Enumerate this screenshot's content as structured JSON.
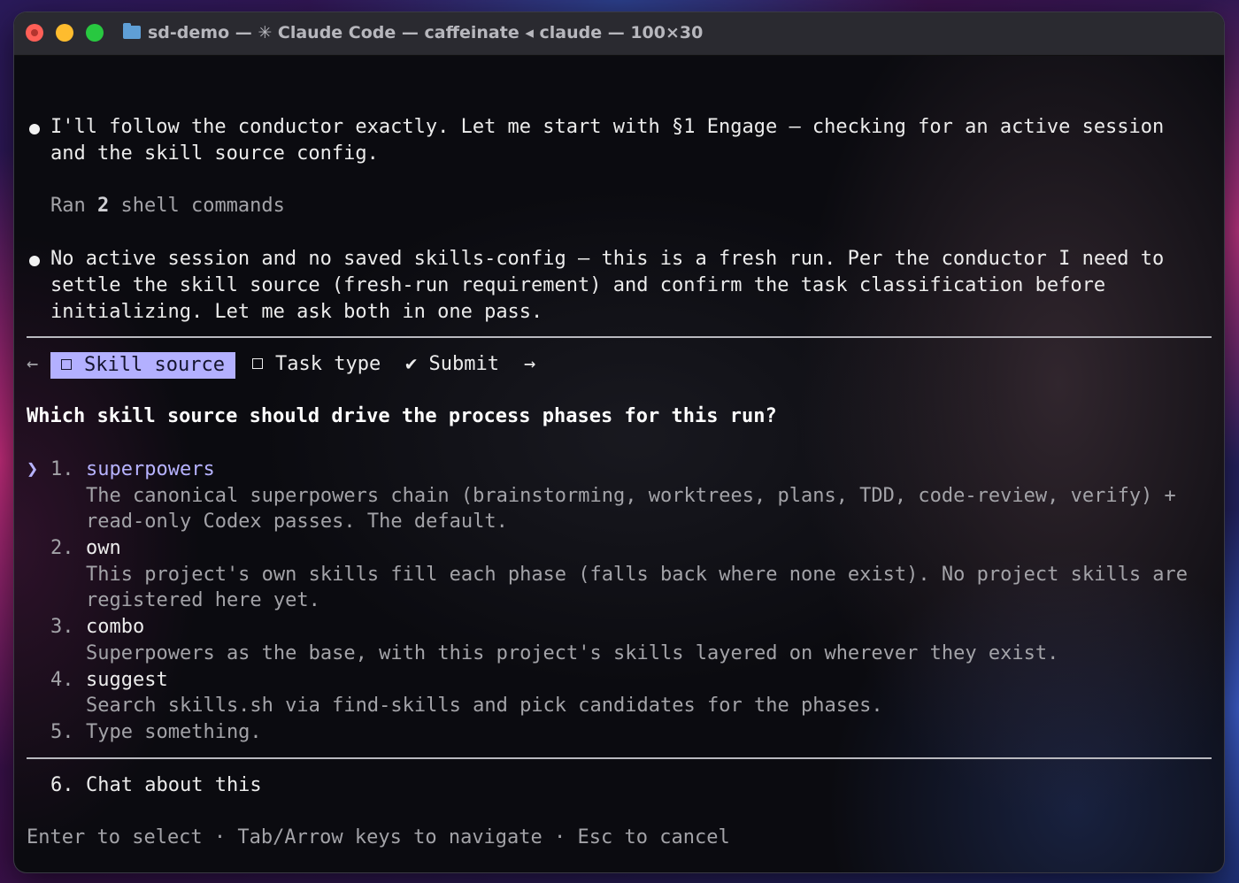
{
  "window": {
    "title": "sd-demo — ✳ Claude Code — caffeinate ◂ claude — 100×30"
  },
  "messages": [
    {
      "line1": "I'll follow the conductor exactly. Let me start with §1 Engage – checking for an active session",
      "line2": "and the skill source config."
    },
    {
      "ran_prefix": "Ran ",
      "ran_count": "2",
      "ran_suffix": " shell commands"
    },
    {
      "line1": "No active session and no saved skills-config – this is a fresh run. Per the conductor I need to",
      "line2": "settle the skill source (fresh-run requirement) and confirm the task classification before",
      "line3": "initializing. Let me ask both in one pass."
    }
  ],
  "tabs": {
    "left_arrow": "←",
    "items": [
      {
        "label": "Skill source"
      },
      {
        "label": "Task type"
      },
      {
        "check": "✔",
        "label": "Submit"
      }
    ],
    "right_arrow": "→"
  },
  "question": "Which skill source should drive the process phases for this run?",
  "options": [
    {
      "num": "1.",
      "label": "superpowers",
      "desc1": "The canonical superpowers chain (brainstorming, worktrees, plans, TDD, code-review, verify) +",
      "desc2": "read-only Codex passes. The default."
    },
    {
      "num": "2.",
      "label": "own",
      "desc1": "This project's own skills fill each phase (falls back where none exist). No project skills are",
      "desc2": "registered here yet."
    },
    {
      "num": "3.",
      "label": "combo",
      "desc1": "Superpowers as the base, with this project's skills layered on wherever they exist."
    },
    {
      "num": "4.",
      "label": "suggest",
      "desc1": "Search skills.sh via find-skills and pick candidates for the phases."
    },
    {
      "num": "5.",
      "label": "Type something."
    }
  ],
  "chat_option": {
    "num": "6.",
    "label": "Chat about this"
  },
  "selector": "❯",
  "footer": "Enter to select · Tab/Arrow keys to navigate · Esc to cancel",
  "colors": {
    "accent": "#b3b0ff",
    "text": "#ececec",
    "dim": "#a3a3a8"
  }
}
